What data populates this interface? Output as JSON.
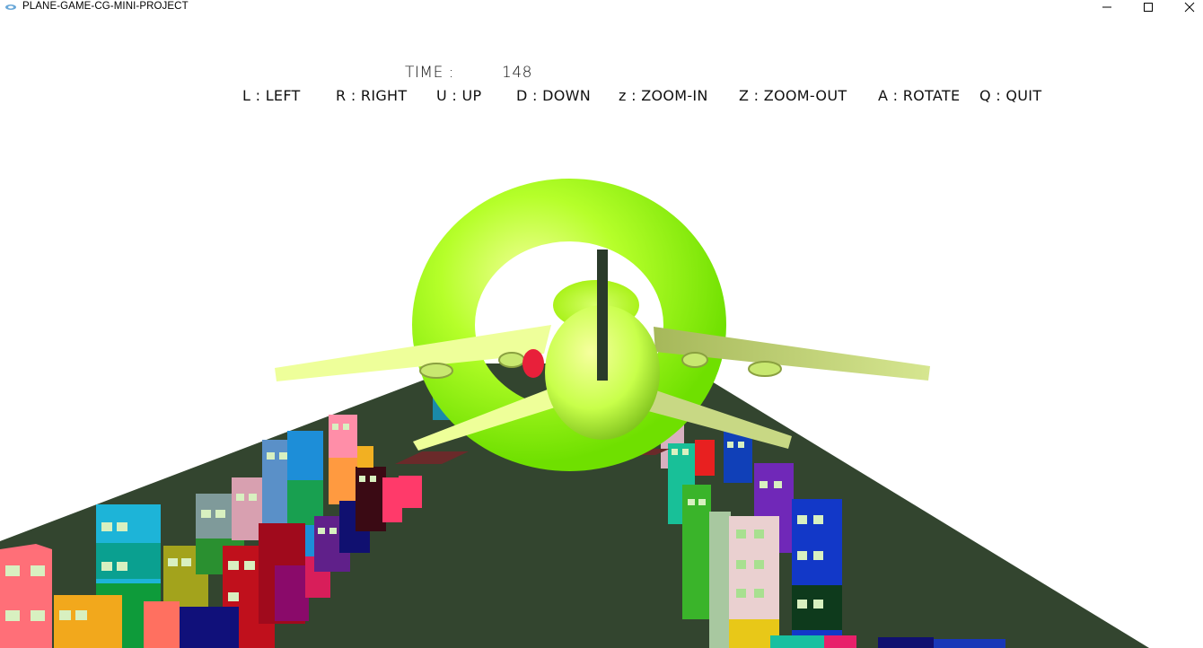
{
  "window": {
    "title": "PLANE-GAME-CG-MINI-PROJECT"
  },
  "hud": {
    "time_label": "TIME :",
    "time_value": "148",
    "controls": [
      {
        "key": "L",
        "sep": ":",
        "action": "LEFT"
      },
      {
        "key": "R",
        "sep": ":",
        "action": "RIGHT"
      },
      {
        "key": "U",
        "sep": ":",
        "action": "UP"
      },
      {
        "key": "D",
        "sep": ":",
        "action": "DOWN"
      },
      {
        "key": "z",
        "sep": ":",
        "action": "ZOOM-IN"
      },
      {
        "key": "Z",
        "sep": ":",
        "action": "ZOOM-OUT"
      },
      {
        "key": "A",
        "sep": ":",
        "action": "ROTATE"
      },
      {
        "key": "Q",
        "sep": ":",
        "action": "QUIT"
      }
    ]
  },
  "colors": {
    "ground": "#33452f",
    "ring": "#99ff00",
    "plane_body": "#dfff7a",
    "wing": "#eeff99",
    "tail_fin": "#2a3a2a"
  }
}
